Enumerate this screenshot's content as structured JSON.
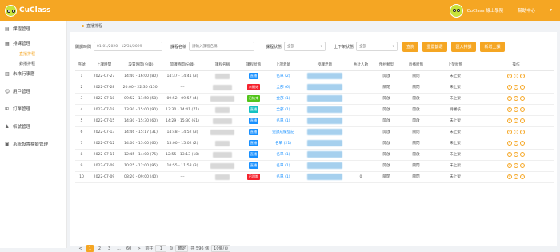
{
  "app": {
    "logo_text": "CuClass"
  },
  "topbar": {
    "user_label": "CuClass 線上學院",
    "help_label": "幫助中心"
  },
  "sidebar": {
    "items": [
      {
        "label": "課程管理",
        "icon": "book-icon"
      },
      {
        "label": "排課管理",
        "icon": "calendar-icon"
      },
      {
        "label": "未來行事曆",
        "icon": "schedule-icon"
      },
      {
        "label": "用戶管理",
        "icon": "user-icon"
      },
      {
        "label": "訂單管理",
        "icon": "cart-icon"
      },
      {
        "label": "帳號管理",
        "icon": "account-icon"
      },
      {
        "label": "系統設置標籤管理",
        "icon": "settings-icon"
      }
    ],
    "subitems": [
      "直播排程",
      "錄播排程"
    ]
  },
  "tab": {
    "label": "直播排程"
  },
  "filters": {
    "date_label": "開課時間",
    "date_value": "01-01/2020 - 12/31/2099",
    "name_label": "課程名稱",
    "name_placeholder": "請輸入課程名稱",
    "status_label": "課程狀態",
    "status_value": "全部",
    "live_label": "上下架狀態",
    "live_value": "全部",
    "btn_search": "查詢",
    "btn_reset": "重置篩選",
    "btn_import": "匯入排課",
    "btn_add": "新增上課"
  },
  "table": {
    "headers": [
      "序號",
      "上課時間",
      "設置時間(分鐘)",
      "開課時間(分鐘)",
      "課程名稱",
      "課程狀態",
      "上課老師",
      "授課老師",
      "共計人數",
      "預約類型",
      "直播狀態",
      "上架狀態",
      "操作"
    ],
    "rows": [
      {
        "no": "1",
        "date": "2022-07-27",
        "set": "14:40 - 16:00 (80)",
        "open": "14:37 - 14:41 (3)",
        "status": "直播",
        "status_color": "#1890ff",
        "teacher": "名單 (2)",
        "count": "",
        "type": "開啟",
        "live": "關閉",
        "shelf": "未上架"
      },
      {
        "no": "2",
        "date": "2022-07-28",
        "set": "20:00 - 22:30 (150)",
        "open": "---",
        "status": "未開始",
        "status_color": "#f5222d",
        "teacher": "全部 (6)",
        "count": "",
        "type": "關閉",
        "live": "關閉",
        "shelf": "未上架"
      },
      {
        "no": "3",
        "date": "2022-07-18",
        "set": "09:52 - 11:50 (58)",
        "open": "09:52 - 09:57 (4)",
        "status": "已結束",
        "status_color": "#52c41a",
        "teacher": "全部 (1)",
        "count": "",
        "type": "開啟",
        "live": "開啟",
        "shelf": "未上架"
      },
      {
        "no": "4",
        "date": "2022-07-18",
        "set": "13:30 - 15:00 (90)",
        "open": "13:30 - 14:41 (71)",
        "status": "直播",
        "status_color": "#13c2c2",
        "teacher": "全部 (1)",
        "count": "",
        "type": "開啟",
        "live": "開啟",
        "shelf": "待審核"
      },
      {
        "no": "5",
        "date": "2022-07-15",
        "set": "14:30 - 15:30 (60)",
        "open": "14:29 - 15:30 (61)",
        "status": "直播",
        "status_color": "#1890ff",
        "teacher": "名單 (1)",
        "count": "",
        "type": "開啟",
        "live": "開啟",
        "shelf": "未上架"
      },
      {
        "no": "6",
        "date": "2022-07-13",
        "set": "14:46 - 15:17 (31)",
        "open": "14:48 - 14:52 (3)",
        "status": "直播",
        "status_color": "#1890ff",
        "teacher": "完課成績登記",
        "count": "",
        "type": "開啟",
        "live": "關閉",
        "shelf": "未上架"
      },
      {
        "no": "7",
        "date": "2022-07-12",
        "set": "14:00 - 15:00 (60)",
        "open": "15:00 - 15:02 (2)",
        "status": "直播",
        "status_color": "#1890ff",
        "teacher": "名單 (21)",
        "count": "",
        "type": "開啟",
        "live": "關閉",
        "shelf": "未上架"
      },
      {
        "no": "8",
        "date": "2022-07-11",
        "set": "12:45 - 14:00 (75)",
        "open": "12:55 - 13:13 (18)",
        "status": "直播",
        "status_color": "#1890ff",
        "teacher": "名單 (1)",
        "count": "",
        "type": "開啟",
        "live": "開啟",
        "shelf": "未上架"
      },
      {
        "no": "9",
        "date": "2022-07-09",
        "set": "10:25 - 12:00 (95)",
        "open": "10:55 - 11:58 (3)",
        "status": "直播",
        "status_color": "#1890ff",
        "teacher": "名單 (1)",
        "count": "",
        "type": "開啟",
        "live": "關閉",
        "shelf": "未上架"
      },
      {
        "no": "10",
        "date": "2022-07-09",
        "set": "08:20 - 09:00 (40)",
        "open": "---",
        "status": "已過期",
        "status_color": "#f5222d",
        "teacher": "名單 (1)",
        "count": "0",
        "type": "關閉",
        "live": "關閉",
        "shelf": "未上架"
      }
    ]
  },
  "pager": {
    "prev": "<",
    "pages": [
      "1",
      "2",
      "3",
      "...",
      "60"
    ],
    "next": ">",
    "goto_label": "前往",
    "goto_value": "1",
    "page_unit": "頁",
    "confirm": "確定",
    "total": "共 596 條",
    "per_page": "10條/頁"
  },
  "colors": {
    "accent": "#f5a623"
  }
}
